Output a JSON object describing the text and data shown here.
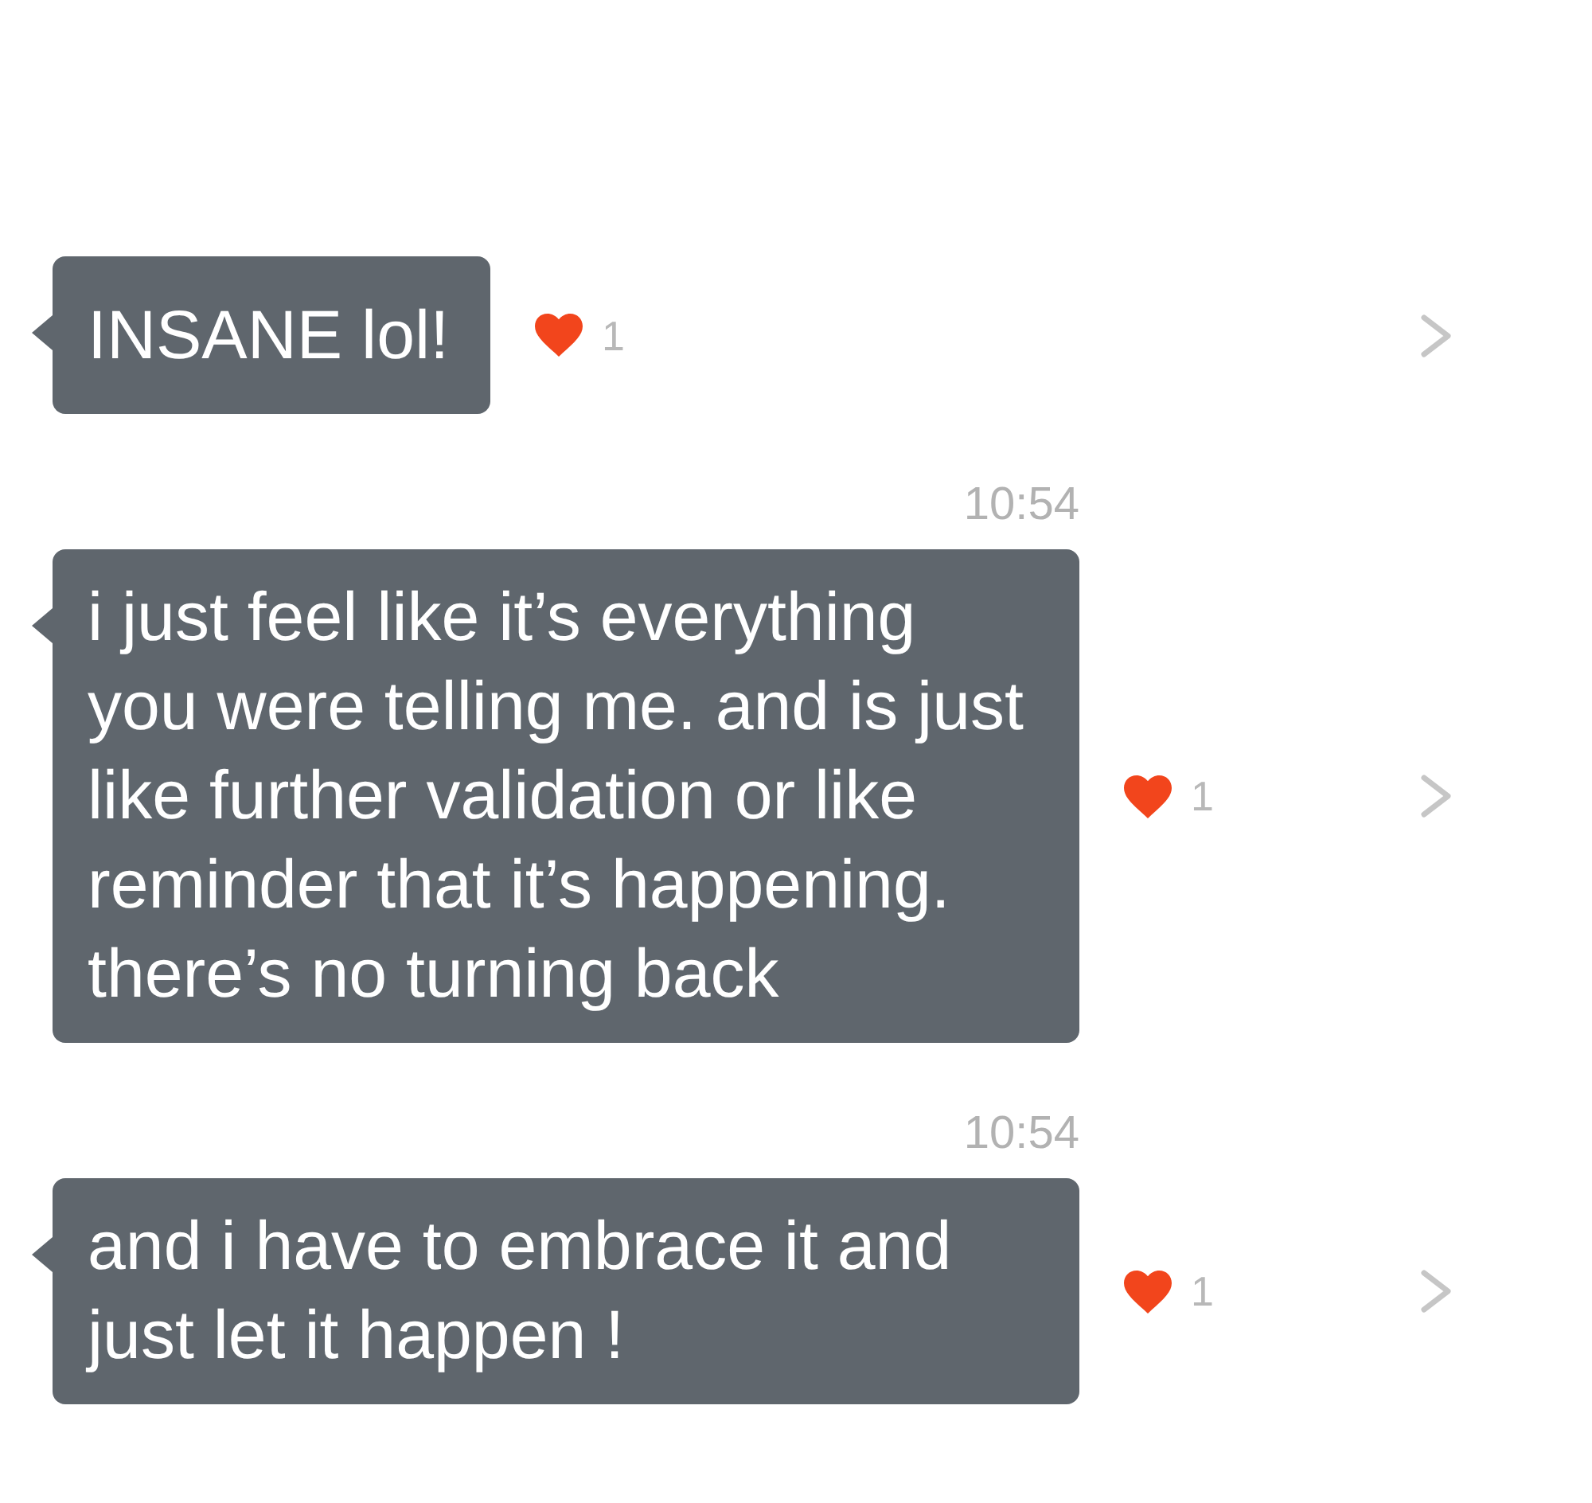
{
  "messages": [
    {
      "text": "INSANE lol!",
      "reaction_count": "1"
    },
    {
      "timestamp": "10:54",
      "text": "i just feel like it’s everything you were telling me. and is just like further validation or like reminder that it’s happening. there’s no turning back",
      "reaction_count": "1"
    },
    {
      "timestamp": "10:54",
      "text": "and i have to embrace it and just let it happen !",
      "reaction_count": "1"
    }
  ]
}
